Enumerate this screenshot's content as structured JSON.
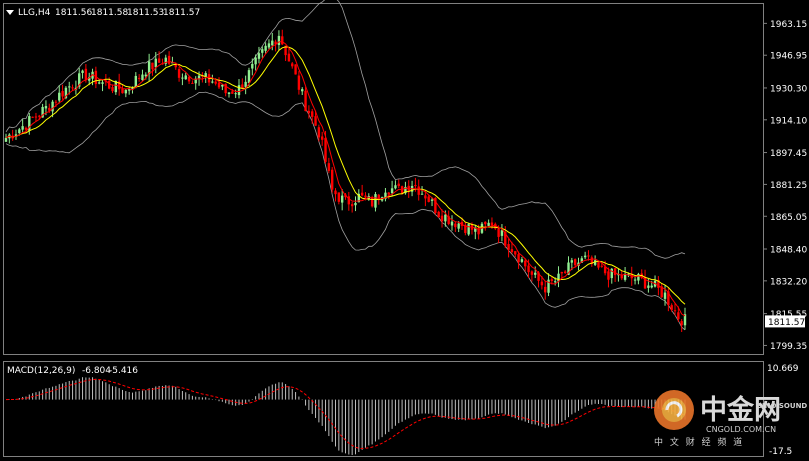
{
  "header": {
    "symbol_label": "LLG,H4",
    "ohlc": [
      "1811.56",
      "1811.58",
      "1811.53",
      "1811.57"
    ]
  },
  "colors": {
    "background": "#000000",
    "bull": "#90ee90",
    "bear": "#ff0000",
    "ma_fast": "#ff0000",
    "ma_slow": "#ffff00",
    "bands": "#a0a0a0",
    "macd_hist": "#c0c0c0",
    "macd_signal": "#ff0000",
    "price_tag_bg": "#ffffff",
    "price_tag_text": "#000000"
  },
  "price_panel": {
    "ticks": [
      "1963.15",
      "1946.95",
      "1930.30",
      "1914.10",
      "1897.45",
      "1881.25",
      "1865.05",
      "1848.40",
      "1832.20",
      "1815.55",
      "1799.35"
    ],
    "last_price": "1811.57",
    "ylim": [
      1795,
      1973
    ]
  },
  "macd_panel": {
    "label": "MACD(12,26,9)",
    "main": "-6.804",
    "signal": "-5.416",
    "ticks": [
      "10.669",
      "-17.5"
    ],
    "ylim": [
      -18,
      12
    ]
  },
  "watermark": {
    "brand": "中金网",
    "domain": "CNGOLD.COM.CN",
    "tagline": "中 文 财 经 频 道",
    "sound": "SINO SOUND"
  },
  "chart_data": {
    "type": "candlestick",
    "interval": "H4",
    "anchors": [
      [
        0,
        1905
      ],
      [
        6,
        1912
      ],
      [
        12,
        1920
      ],
      [
        18,
        1930
      ],
      [
        24,
        1937
      ],
      [
        30,
        1932
      ],
      [
        36,
        1929
      ],
      [
        42,
        1940
      ],
      [
        48,
        1945
      ],
      [
        52,
        1938
      ],
      [
        56,
        1936
      ],
      [
        62,
        1934
      ],
      [
        66,
        1928
      ],
      [
        70,
        1930
      ],
      [
        74,
        1940
      ],
      [
        78,
        1950
      ],
      [
        82,
        1958
      ],
      [
        86,
        1940
      ],
      [
        90,
        1922
      ],
      [
        94,
        1908
      ],
      [
        98,
        1878
      ],
      [
        102,
        1872
      ],
      [
        106,
        1875
      ],
      [
        110,
        1872
      ],
      [
        114,
        1880
      ],
      [
        118,
        1878
      ],
      [
        122,
        1882
      ],
      [
        126,
        1876
      ],
      [
        130,
        1867
      ],
      [
        134,
        1863
      ],
      [
        138,
        1860
      ],
      [
        142,
        1857
      ],
      [
        146,
        1862
      ],
      [
        150,
        1853
      ],
      [
        154,
        1845
      ],
      [
        158,
        1835
      ],
      [
        162,
        1829
      ],
      [
        166,
        1833
      ],
      [
        170,
        1840
      ],
      [
        174,
        1843
      ],
      [
        178,
        1838
      ],
      [
        182,
        1835
      ],
      [
        186,
        1834
      ],
      [
        190,
        1833
      ],
      [
        194,
        1830
      ],
      [
        198,
        1825
      ],
      [
        202,
        1814
      ],
      [
        204,
        1812
      ]
    ],
    "bar_count": 205,
    "ma_periods": [
      5,
      10
    ],
    "bollinger_period": 20,
    "bollinger_dev": 2,
    "macd_params": [
      12,
      26,
      9
    ]
  }
}
